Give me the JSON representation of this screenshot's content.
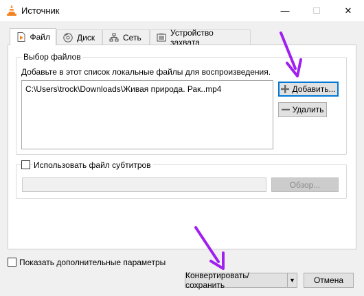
{
  "window": {
    "title": "Источник",
    "minimize_glyph": "—",
    "maximize_glyph": "☐",
    "close_glyph": "✕"
  },
  "tabs": [
    {
      "label": "Файл",
      "icon": "file-play-icon",
      "active": true
    },
    {
      "label": "Диск",
      "icon": "disc-icon",
      "active": false
    },
    {
      "label": "Сеть",
      "icon": "network-icon",
      "active": false
    },
    {
      "label": "Устройство захвата",
      "icon": "capture-device-icon",
      "active": false
    }
  ],
  "file_selection": {
    "group_title": "Выбор файлов",
    "hint": "Добавьте в этот список локальные файлы для воспроизведения.",
    "files": [
      "C:\\Users\\trock\\Downloads\\Живая природа. Рак..mp4"
    ],
    "add_label": "Добавить...",
    "remove_label": "Удалить"
  },
  "subtitles": {
    "checkbox_label": "Использовать файл субтитров",
    "checked": false,
    "path_value": "",
    "browse_label": "Обзор..."
  },
  "footer": {
    "show_more_label": "Показать дополнительные параметры",
    "show_more_checked": false,
    "convert_label": "Конвертировать/сохранить",
    "cancel_label": "Отмена"
  },
  "colors": {
    "annotation_arrow": "#a020f0",
    "vlc_orange": "#f58220",
    "focus_blue": "#0078d7"
  }
}
